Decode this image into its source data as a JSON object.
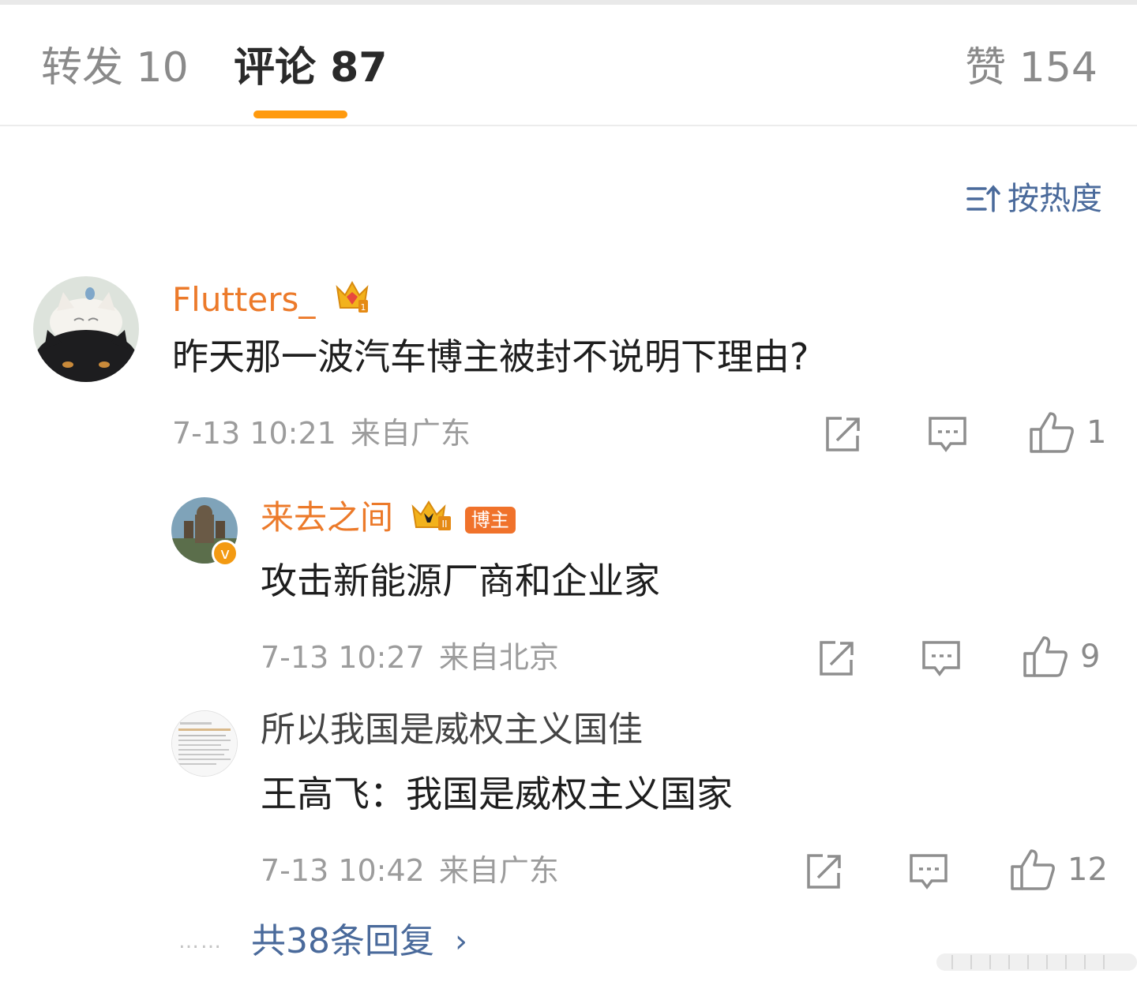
{
  "tabs": {
    "repost": "转发 10",
    "comment": "评论 87",
    "like": "赞 154"
  },
  "sort": {
    "label": "按热度"
  },
  "comments": [
    {
      "username": "Flutters_",
      "text": "昨天那一波汽车博主被封不说明下理由?",
      "time": "7-13 10:21",
      "location": "来自广东",
      "likes": "1"
    },
    {
      "username": "来去之间",
      "badge": "博主",
      "text": "攻击新能源厂商和企业家",
      "time": "7-13 10:27",
      "location": "来自北京",
      "likes": "9"
    },
    {
      "username": "所以我国是威权主义国佳",
      "text": "王高飞：我国是威权主义国家",
      "time": "7-13 10:42",
      "location": "来自广东",
      "likes": "12"
    }
  ],
  "replies": {
    "dots": "……",
    "total": "共38条回复",
    "chevron": "›"
  },
  "colors": {
    "accent": "#ff9a0e",
    "username": "#ec7a2a",
    "link": "#4a6a9b",
    "meta": "#9c9c9c"
  }
}
